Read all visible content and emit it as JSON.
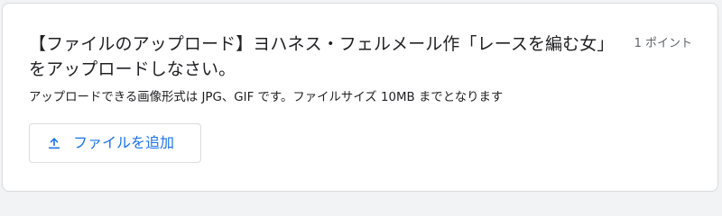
{
  "question": {
    "title": "【ファイルのアップロード】ヨハネス・フェルメール作「レースを編む女」をアップロードしなさい。",
    "points": "1 ポイント",
    "helper_text": "アップロードできる画像形式は JPG、GIF です。ファイルサイズ 10MB までとなります"
  },
  "upload_button": {
    "label": "ファイルを追加",
    "icon": "upload-icon"
  },
  "colors": {
    "background": "#f1f3f4",
    "card": "#ffffff",
    "border": "#dadce0",
    "accent": "#1a73e8",
    "text": "#202124",
    "muted_text": "#5f6368"
  }
}
